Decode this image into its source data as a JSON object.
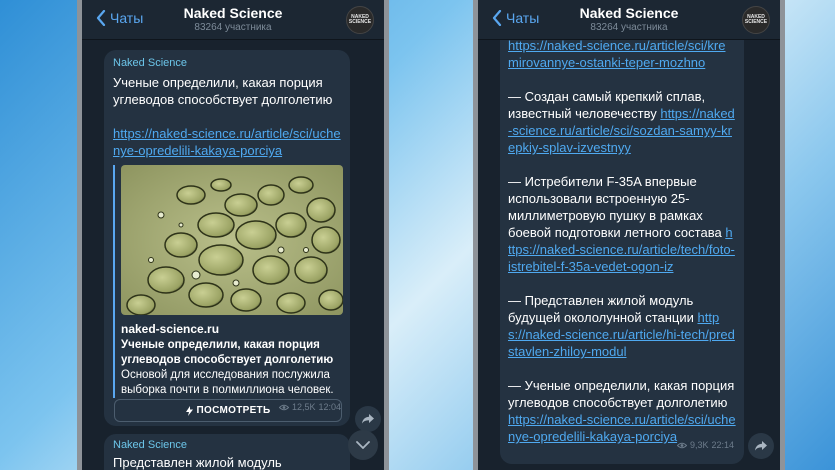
{
  "left": {
    "back_label": "Чаты",
    "title": "Naked Science",
    "subtitle": "83264 участника",
    "avatar_text": "NAKED SCIENCE",
    "message": {
      "sender": "Naked Science",
      "text": "Ученые определили, какая порция углеводов способствует долголетию",
      "link": "https://naked-science.ru/article/sci/uchenye-opredelili-kakaya-porciya",
      "preview": {
        "site": "naked-science.ru",
        "title": "Ученые определили, какая порция углеводов способствует долголетию",
        "description": "Основой для исследования послужила выборка почти в полмиллиона человек."
      },
      "views": "12,5K",
      "time": "12:04",
      "button_label": "ПОСМОТРЕТЬ"
    },
    "next_message": {
      "sender": "Naked Science",
      "text": "Представлен жилой модуль"
    }
  },
  "right": {
    "back_label": "Чаты",
    "title": "Naked Science",
    "subtitle": "83264 участника",
    "avatar_text": "NAKED SCIENCE",
    "top_link": "https://naked-science.ru/article/sci/kremirovannye-ostanki-teper-mozhno",
    "items": [
      {
        "text": "— Создан самый крепкий сплав, известный человечеству ",
        "link": "https://naked-science.ru/article/sci/sozdan-samyy-krepkiy-splav-izvestnyy"
      },
      {
        "text": "— Истребители F-35A впервые использовали встроенную 25-миллиметровую пушку в рамках боевой подготовки летного состава ",
        "link": "https://naked-science.ru/article/tech/foto-istrebitel-f-35a-vedet-ogon-iz"
      },
      {
        "text": "— Представлен жилой модуль будущей окололунной станции ",
        "link": "https://naked-science.ru/article/hi-tech/predstavlen-zhiloy-modul"
      },
      {
        "text": "— Ученые определили, какая порция углеводов способствует долголетию ",
        "link": "https://naked-science.ru/article/sci/uchenye-opredelili-kakaya-porciya"
      }
    ],
    "views": "9,3K",
    "time": "22:14"
  },
  "colors": {
    "accent": "#4fa9f0",
    "sender": "#6cc5e9",
    "bubble": "#243241",
    "background": "#18222d"
  }
}
